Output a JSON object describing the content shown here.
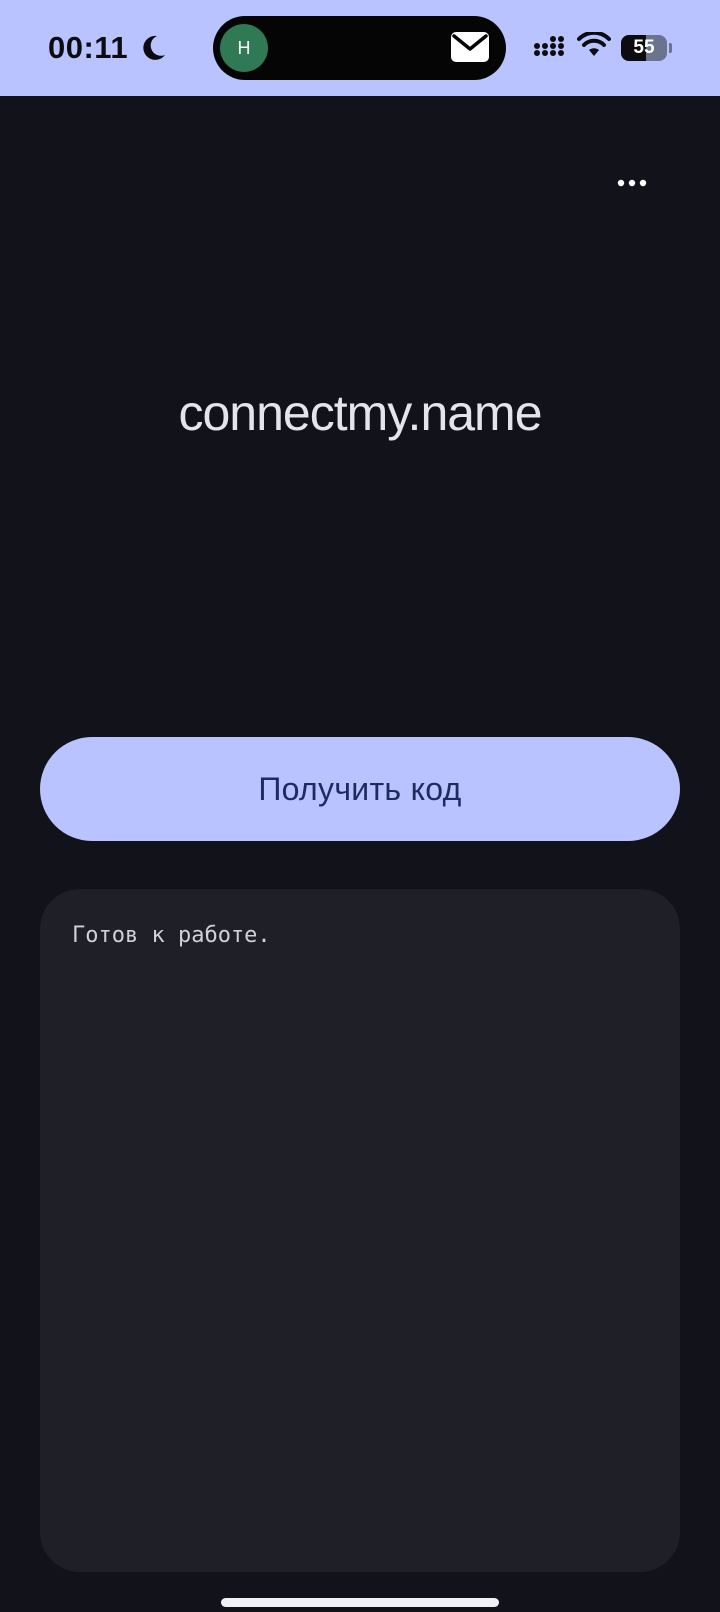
{
  "status_bar": {
    "time": "00:11",
    "avatar_letter": "Н",
    "battery_level": "55",
    "icons": [
      "moon-icon",
      "mail-icon",
      "signal-icon",
      "wifi-icon",
      "battery-icon"
    ],
    "background_color": "#b8c3ff"
  },
  "header": {
    "menu_icon": "more-horizontal-icon"
  },
  "main": {
    "title": "connectmy.name",
    "button_label": "Получить код",
    "log_text": "Готов к работе."
  },
  "colors": {
    "background": "#12131a",
    "accent": "#b8c3ff",
    "button_text": "#1f2a5e",
    "panel": "#1f1f28",
    "avatar": "#2f7a55"
  }
}
